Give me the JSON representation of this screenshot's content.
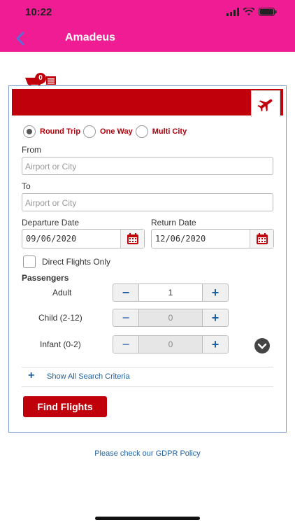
{
  "status": {
    "time": "10:22"
  },
  "nav": {
    "title": "Amadeus"
  },
  "cart": {
    "count": "0"
  },
  "trip": {
    "options": [
      "Round Trip",
      "One Way",
      "Multi City"
    ],
    "selected": "Round Trip"
  },
  "from": {
    "label": "From",
    "placeholder": "Airport or City"
  },
  "to": {
    "label": "To",
    "placeholder": "Airport or City"
  },
  "departure": {
    "label": "Departure Date",
    "value": "09/06/2020"
  },
  "return_date": {
    "label": "Return Date",
    "value": "12/06/2020"
  },
  "direct": {
    "label": "Direct Flights Only",
    "checked": false
  },
  "passengers": {
    "title": "Passengers",
    "adult": {
      "label": "Adult",
      "value": "1"
    },
    "child": {
      "label": "Child (2-12)",
      "value": "0"
    },
    "infant": {
      "label": "Infant (0-2)",
      "value": "0"
    }
  },
  "show_all": {
    "label": "Show All Search Criteria"
  },
  "find_button": {
    "label": "Find Flights"
  },
  "gdpr": {
    "text": "Please check our GDPR Policy"
  },
  "colors": {
    "brand_pink": "#ef1c93",
    "brand_red": "#c0000a",
    "link_blue": "#1f5fa0"
  }
}
